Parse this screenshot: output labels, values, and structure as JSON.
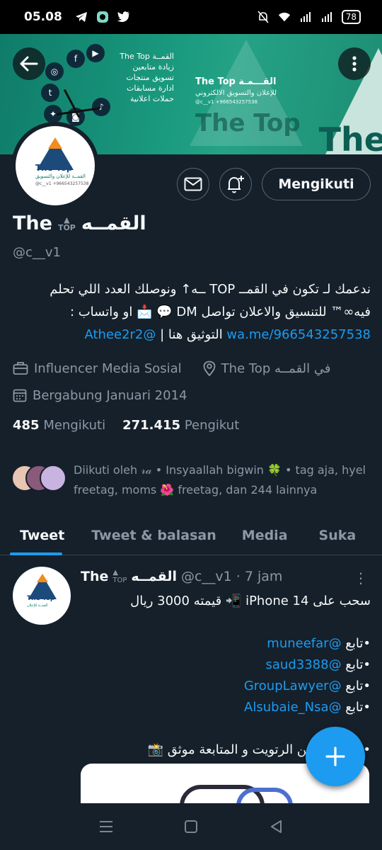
{
  "status_bar": {
    "time": "05.08",
    "battery": "78"
  },
  "banner": {
    "left_lines": [
      "The Top القمــة",
      "زيادة متابعين",
      "تسويق منتجات",
      "ادارة مسابقات",
      "حملات اعلانية"
    ],
    "center_title": "The Top القـــمـة",
    "center_sub": "للإعلان والتسويق الالكتروني",
    "center_contact": "@c__v1    +966543257538",
    "ghost_brand": "The Top",
    "big_brand": "The"
  },
  "profile": {
    "avatar_brand": "The Top",
    "avatar_sub": "القمــة للإعلان والتسويق",
    "avatar_small": "@c__v1  +966543257538",
    "name_start": "The",
    "name_emoji": "TOP",
    "name_end": "القمــه",
    "handle": "@c__v1",
    "follow_button": "Mengikuti",
    "bio_line1": "ندعمك لـ تكون في القمــ TOP ــه↑ ونوصلك العدد اللي تحلم",
    "bio_line2": "فيه∞™ للتنسيق والاعلان تواصل DM 💬 📩 او واتساب :",
    "bio_link_wa": "wa.me/966543257538",
    "bio_mid": " التوثيق هنا | ",
    "bio_link_mention": "@Athee2r2",
    "category": "Influencer Media Sosial",
    "location": "The Top في القمــه",
    "joined": "Bergabung Januari 2014",
    "following_count": "485",
    "following_label": "Mengikuti",
    "followers_count": "271.415",
    "followers_label": "Pengikut",
    "followed_by": "Diikuti oleh 𝓇𝒶 • Insyaallah bigwin 🍀 • tag aja, hyel freetag, moms 🌺 freetag, dan 244 lainnya"
  },
  "tabs": [
    {
      "label": "Tweet"
    },
    {
      "label": "Tweet & balasan"
    },
    {
      "label": "Media"
    },
    {
      "label": "Suka"
    }
  ],
  "tweet": {
    "avatar_brand": "The Top",
    "avatar_sub": "القمــة للإعلان",
    "name_start": "The",
    "name_emoji": "TOP",
    "name_end": "القمــه",
    "handle_time": "@c__v1 · 7 jam",
    "line1": "سحب على iPhone 14 📲 قيمته 3000 ريال",
    "follow1_prefix": "•تابع ",
    "follow1": "@muneefar",
    "follow2_prefix": "•تابع ",
    "follow2": "@saud3388",
    "follow3_prefix": "•تابع ",
    "follow3": "@GroupLawyer",
    "follow4_prefix": "•تابع ",
    "follow4": "@Alsubaie_Nsa",
    "line_last": "•الكتروني من الرتويت و المتابعة موثق 📸"
  },
  "colors": {
    "background": "#15202b",
    "accent": "#1d9bf0",
    "muted": "#8b98a5",
    "banner": "#1a9a7f"
  },
  "icons": {
    "back": "back-arrow-icon",
    "more": "more-vertical-icon",
    "mail": "mail-icon",
    "notify": "bell-plus-icon",
    "category": "briefcase-icon",
    "location": "location-pin-icon",
    "calendar": "calendar-icon",
    "compose": "plus-icon"
  }
}
